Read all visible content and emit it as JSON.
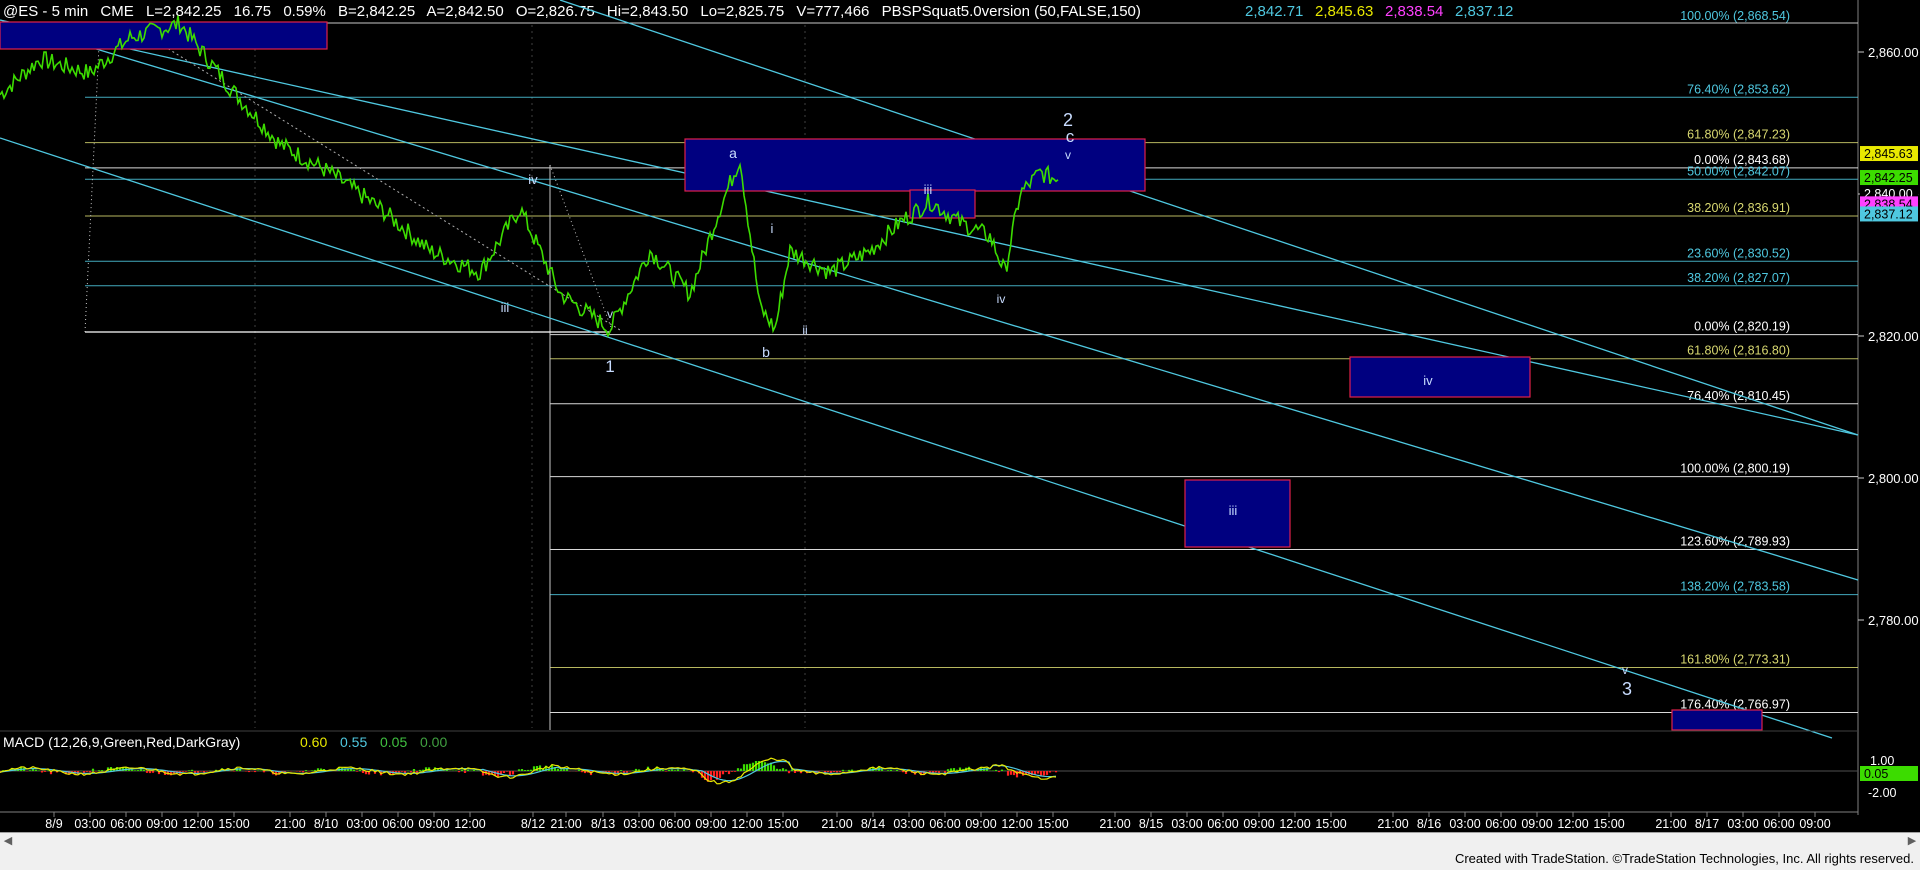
{
  "header": {
    "symbol": "@ES - 5 min",
    "exchange": "CME",
    "last": "L=2,842.25",
    "change": "16.75",
    "change_pct": "0.59%",
    "bid": "B=2,842.25",
    "ask": "A=2,842.50",
    "open": "O=2,826.75",
    "high": "Hi=2,843.50",
    "low": "Lo=2,825.75",
    "volume": "V=777,466",
    "study": "PBSPSquat5.0version (50,FALSE,150)",
    "study_values": [
      {
        "text": "2,842.71",
        "color": "#4fc8e0"
      },
      {
        "text": "2,845.63",
        "color": "#e8e800"
      },
      {
        "text": "2,838.54",
        "color": "#ff40ff"
      },
      {
        "text": "2,837.12",
        "color": "#4fc8e0"
      }
    ]
  },
  "macd_header": {
    "name": "MACD (12,26,9,Green,Red,DarkGray)",
    "values": [
      {
        "text": "0.60",
        "color": "#e8e800"
      },
      {
        "text": "0.55",
        "color": "#4fc8e0"
      },
      {
        "text": "0.05",
        "color": "#40c040"
      },
      {
        "text": "0.00",
        "color": "#40a040"
      }
    ]
  },
  "chart_data": {
    "type": "line",
    "title": "@ES - 5 min",
    "ylim": [
      2761,
      2866
    ],
    "y_ticks": [
      "2,860.00",
      "2,840.00",
      "2,820.00",
      "2,800.00",
      "2,780.00"
    ],
    "y_tick_values": [
      2860,
      2840,
      2820,
      2800,
      2780
    ],
    "x_tick_labels": [
      "8/9",
      "03:00",
      "06:00",
      "09:00",
      "12:00",
      "15:00",
      "21:00",
      "8/10",
      "03:00",
      "06:00",
      "09:00",
      "12:00",
      "8/12",
      "21:00",
      "8/13",
      "03:00",
      "06:00",
      "09:00",
      "12:00",
      "15:00",
      "21:00",
      "8/14",
      "03:00",
      "06:00",
      "09:00",
      "12:00",
      "15:00",
      "21:00",
      "8/15",
      "03:00",
      "06:00",
      "09:00",
      "12:00",
      "15:00",
      "21:00",
      "8/16",
      "03:00",
      "06:00",
      "09:00",
      "12:00",
      "15:00",
      "21:00",
      "8/17",
      "03:00",
      "06:00",
      "09:00"
    ],
    "price_series": {
      "name": "@ES",
      "color": "#3cdc00",
      "points": [
        [
          0,
          2854
        ],
        [
          40,
          2859
        ],
        [
          90,
          2857
        ],
        [
          130,
          2862
        ],
        [
          180,
          2864
        ],
        [
          230,
          2855
        ],
        [
          280,
          2847
        ],
        [
          330,
          2843
        ],
        [
          380,
          2838
        ],
        [
          430,
          2832
        ],
        [
          480,
          2829
        ],
        [
          520,
          2838
        ],
        [
          560,
          2826
        ],
        [
          610,
          2821
        ],
        [
          650,
          2832
        ],
        [
          690,
          2826
        ],
        [
          720,
          2838
        ],
        [
          740,
          2845
        ],
        [
          760,
          2824
        ],
        [
          775,
          2821
        ],
        [
          790,
          2832
        ],
        [
          830,
          2829
        ],
        [
          870,
          2832
        ],
        [
          900,
          2836
        ],
        [
          930,
          2839
        ],
        [
          960,
          2836
        ],
        [
          990,
          2834
        ],
        [
          1005,
          2829
        ],
        [
          1020,
          2840
        ],
        [
          1040,
          2843
        ],
        [
          1058,
          2842
        ]
      ]
    },
    "fib_levels": [
      {
        "label": "100.00% (2,868.54)",
        "value": 2866.0,
        "color": "#4fc8e0"
      },
      {
        "label": "76.40% (2,853.62)",
        "value": 2853.62,
        "color": "#4fc8e0"
      },
      {
        "label": "61.80% (2,847.23)",
        "value": 2847.23,
        "color": "#d8d870"
      },
      {
        "label": "0.00% (2,843.68)",
        "value": 2843.68,
        "color": "#ffffff"
      },
      {
        "label": "50.00% (2,842.07)",
        "value": 2842.07,
        "color": "#4fc8e0"
      },
      {
        "label": "38.20% (2,836.91)",
        "value": 2836.91,
        "color": "#d8d870"
      },
      {
        "label": "23.60% (2,830.52)",
        "value": 2830.52,
        "color": "#4fc8e0"
      },
      {
        "label": "38.20% (2,827.07)",
        "value": 2827.07,
        "color": "#4fc8e0"
      },
      {
        "label": "0.00% (2,820.19)",
        "value": 2820.19,
        "color": "#ffffff"
      },
      {
        "label": "61.80% (2,816.80)",
        "value": 2816.8,
        "color": "#d8d870"
      },
      {
        "label": "76.40% (2,810.45)",
        "value": 2810.45,
        "color": "#ffffff"
      },
      {
        "label": "100.00% (2,800.19)",
        "value": 2800.19,
        "color": "#ffffff"
      },
      {
        "label": "123.60% (2,789.93)",
        "value": 2789.93,
        "color": "#ffffff"
      },
      {
        "label": "138.20% (2,783.58)",
        "value": 2783.58,
        "color": "#4fc8e0"
      },
      {
        "label": "161.80% (2,773.31)",
        "value": 2773.31,
        "color": "#d8d870"
      },
      {
        "label": "176.40% (2,766.97)",
        "value": 2766.97,
        "color": "#ffffff"
      }
    ],
    "price_markers": [
      {
        "text": "2,845.63",
        "value": 2845.63,
        "bg": "#e8e800",
        "fg": "#000000"
      },
      {
        "text": "2,842.25",
        "value": 2842.25,
        "bg": "#3cdc00",
        "fg": "#000000"
      },
      {
        "text": "2,840.00",
        "value": 2840.0,
        "bg": "#000000",
        "fg": "#ffffff"
      },
      {
        "text": "2,838.54",
        "value": 2838.54,
        "bg": "#ff40ff",
        "fg": "#000000"
      },
      {
        "text": "2,837.12",
        "value": 2837.12,
        "bg": "#4fc8e0",
        "fg": "#000000"
      }
    ],
    "wave_labels": [
      "2",
      "iv",
      "iii",
      "v",
      "1",
      "a",
      "i",
      "b",
      "ii",
      "iii",
      "iv",
      "c",
      "v",
      "iv",
      "iii",
      "v",
      "3"
    ],
    "macd_axis": {
      "ticks": [
        "1.00",
        "-2.00"
      ],
      "current": "0.05"
    },
    "macd_series": {
      "macd_color": "#e8e800",
      "signal_color": "#4fc8e0",
      "hist_pos_color": "#3cdc00",
      "hist_neg_color": "#ff2020"
    }
  },
  "footer": {
    "credit": "Created with TradeStation. ©TradeStation Technologies, Inc. All rights reserved."
  },
  "colors": {
    "background": "#000000",
    "channel": "#4fc8e0",
    "box_fill": "#000080",
    "box_border": "#e0204a"
  }
}
